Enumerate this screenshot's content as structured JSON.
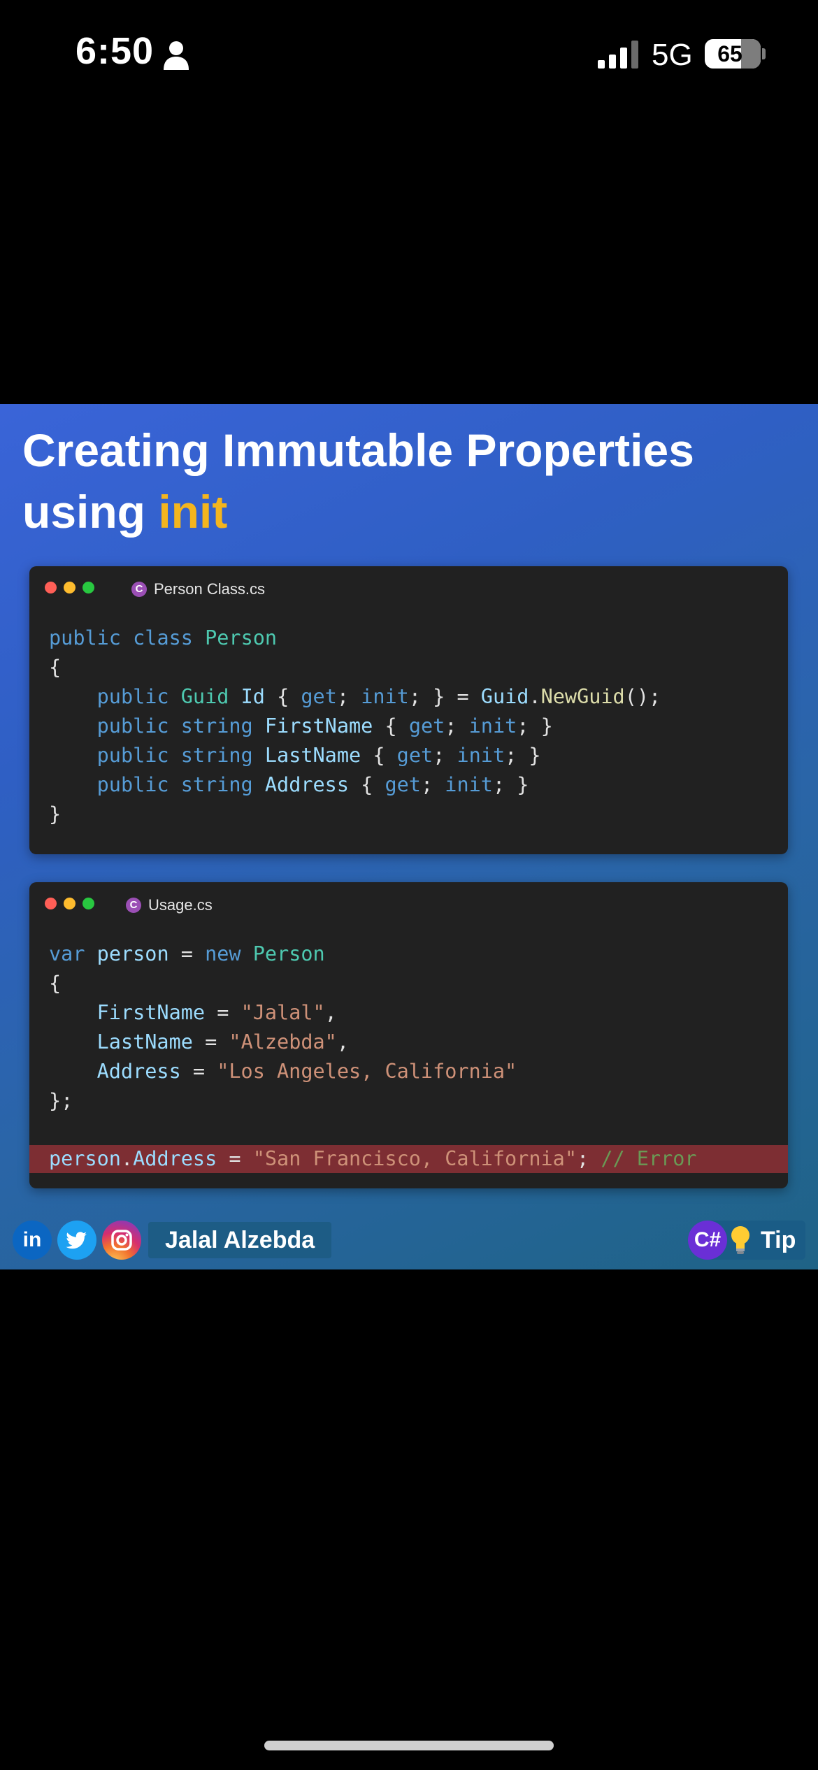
{
  "status_bar": {
    "time": "6:50",
    "network": "5G",
    "battery": "65"
  },
  "slide": {
    "title_main": "Creating Immutable Properties",
    "title_using": "using ",
    "title_accent": "init",
    "accent_color": "#f4b51e"
  },
  "window1": {
    "filename": "Person Class.cs"
  },
  "window2": {
    "filename": "Usage.cs"
  },
  "code": {
    "kw_public": "public",
    "kw_class": "class",
    "kw_string": "string",
    "kw_get": "get",
    "kw_init": "init",
    "kw_var": "var",
    "kw_new": "new",
    "type_person": "Person",
    "type_guid": "Guid",
    "prop_id": "Id",
    "prop_first": "FirstName",
    "prop_last": "LastName",
    "prop_address": "Address",
    "var_person": "person",
    "guid_class": "Guid",
    "method_newguid": "NewGuid",
    "str_first": "\"Jalal\"",
    "str_last": "\"Alzebda\"",
    "str_addr": "\"Los Angeles, California\"",
    "str_error": "\"San Francisco, California\"",
    "comment_error": "// Error"
  },
  "footer": {
    "author": "Jalal Alzebda",
    "csharp": "C#",
    "tip": "Tip",
    "linkedin_glyph": "in"
  },
  "icons": [
    "person-icon",
    "signal-icon",
    "linkedin-icon",
    "twitter-icon",
    "instagram-icon",
    "csharp-icon",
    "lightbulb-icon"
  ]
}
